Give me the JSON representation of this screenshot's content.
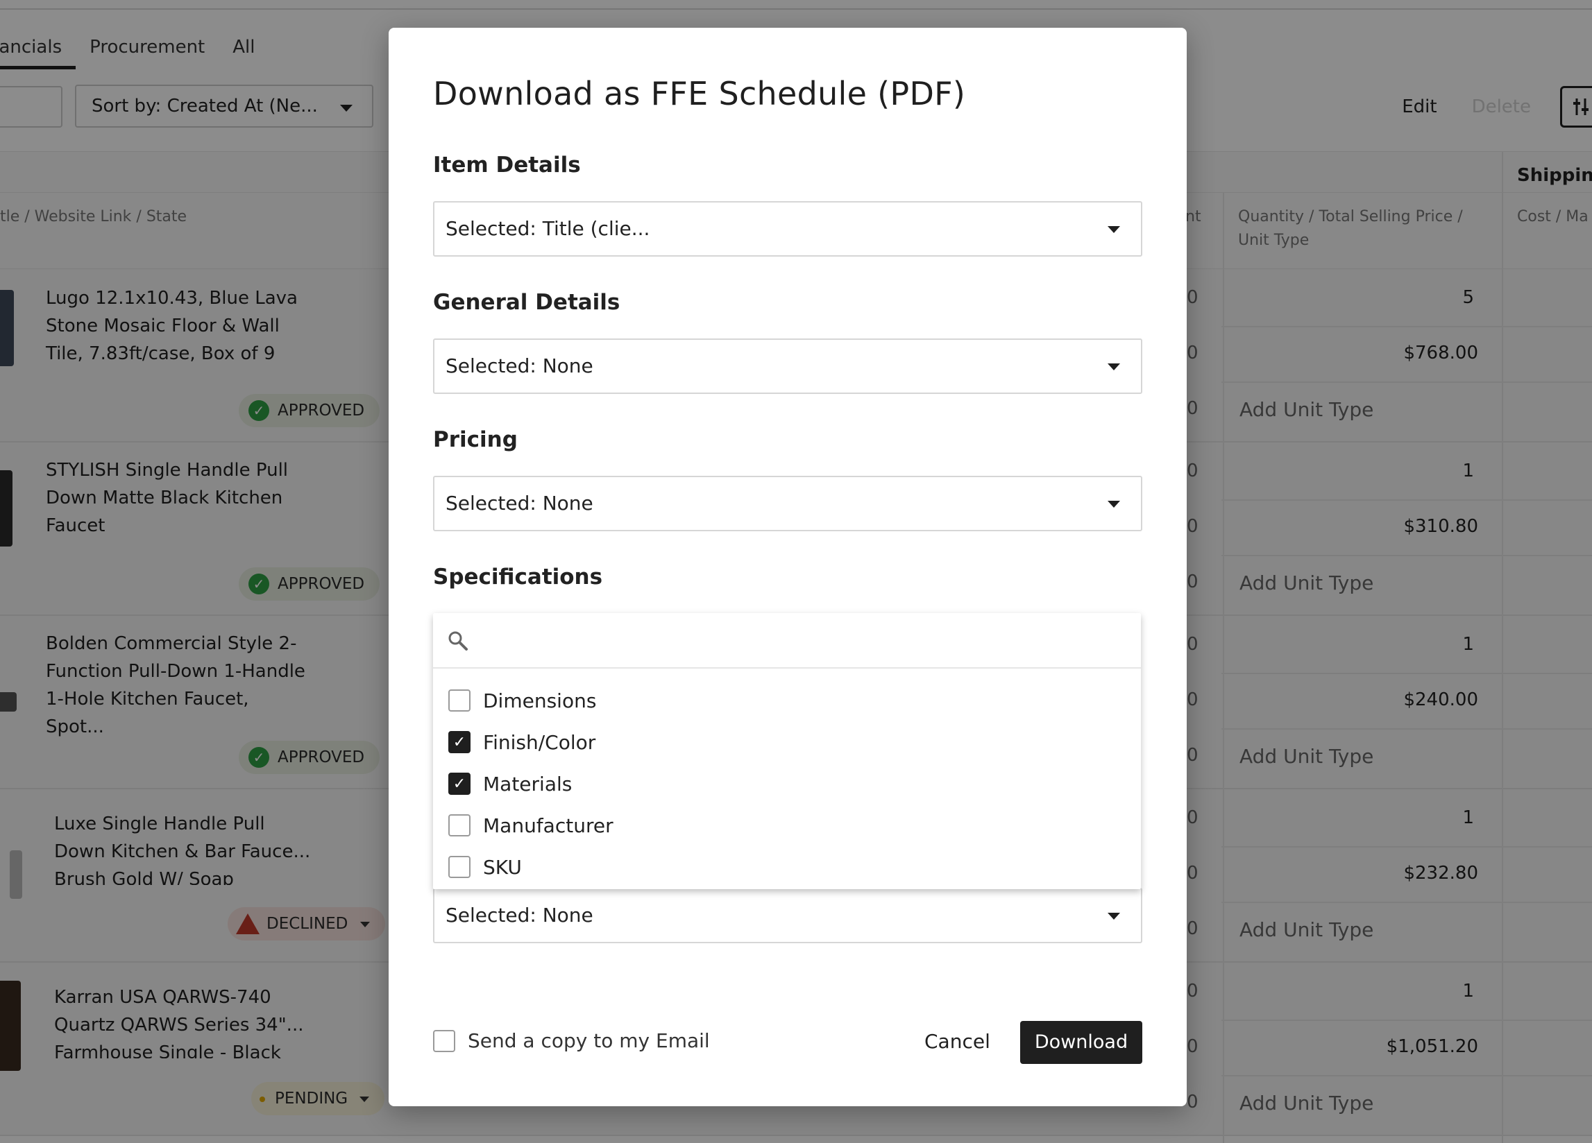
{
  "tabs": [
    {
      "label": "nancials",
      "active": true
    },
    {
      "label": "Procurement",
      "active": false
    },
    {
      "label": "All",
      "active": false
    }
  ],
  "toolbar": {
    "sort_label": "Sort by: Created At (Ne...",
    "edit_label": "Edit",
    "delete_label": "Delete"
  },
  "headers": {
    "shipping": "Shipping",
    "title_col": "tle / Website Link / State",
    "qty_col_1": "Quantity / Total Selling Price /",
    "qty_col_2": "Unit Type",
    "cost_col": "Cost / Ma",
    "partial_col": "nt"
  },
  "rows": [
    {
      "title": "Lugo 12.1x10.43, Blue Lava Stone Mosaic Floor & Wall Tile, 7.83ft/case, Box of 9",
      "status": "APPROVED",
      "qty": "5",
      "price": "$768.00",
      "unit": "Add Unit Type"
    },
    {
      "title": "STYLISH Single Handle Pull Down Matte Black Kitchen Faucet",
      "status": "APPROVED",
      "qty": "1",
      "price": "$310.80",
      "unit": "Add Unit Type"
    },
    {
      "title": "Bolden Commercial Style 2-Function Pull-Down 1-Handle 1-Hole Kitchen Faucet, Spot...",
      "status": "APPROVED",
      "qty": "1",
      "price": "$240.00",
      "unit": "Add Unit Type"
    },
    {
      "title": "Luxe Single Handle Pull Down Kitchen & Bar Fauce... Brush Gold W/ Soap",
      "status": "DECLINED",
      "qty": "1",
      "price": "$232.80",
      "unit": "Add Unit Type"
    },
    {
      "title": "Karran USA QARWS-740 Quartz QARWS Series 34\"... Farmhouse Single - Black",
      "status": "PENDING",
      "qty": "1",
      "price": "$1,051.20",
      "unit": "Add Unit Type"
    }
  ],
  "modal": {
    "title": "Download as FFE Schedule (PDF)",
    "sections": [
      {
        "label": "Item Details",
        "value": "Selected: Title (clie..."
      },
      {
        "label": "General Details",
        "value": "Selected: None"
      },
      {
        "label": "Pricing",
        "value": "Selected: None"
      },
      {
        "label": "Specifications"
      }
    ],
    "hidden_select_value": "Selected: None",
    "search_placeholder": "",
    "options": [
      {
        "label": "Dimensions",
        "checked": false
      },
      {
        "label": "Finish/Color",
        "checked": true
      },
      {
        "label": "Materials",
        "checked": true
      },
      {
        "label": "Manufacturer",
        "checked": false
      },
      {
        "label": "SKU",
        "checked": false
      }
    ],
    "email_copy_label": "Send a copy to my Email",
    "cancel_label": "Cancel",
    "download_label": "Download"
  },
  "colors": {
    "primary": "#1f1f1f",
    "approved": "#2f9e44",
    "declined": "#c0392b",
    "pending": "#e0a800"
  }
}
